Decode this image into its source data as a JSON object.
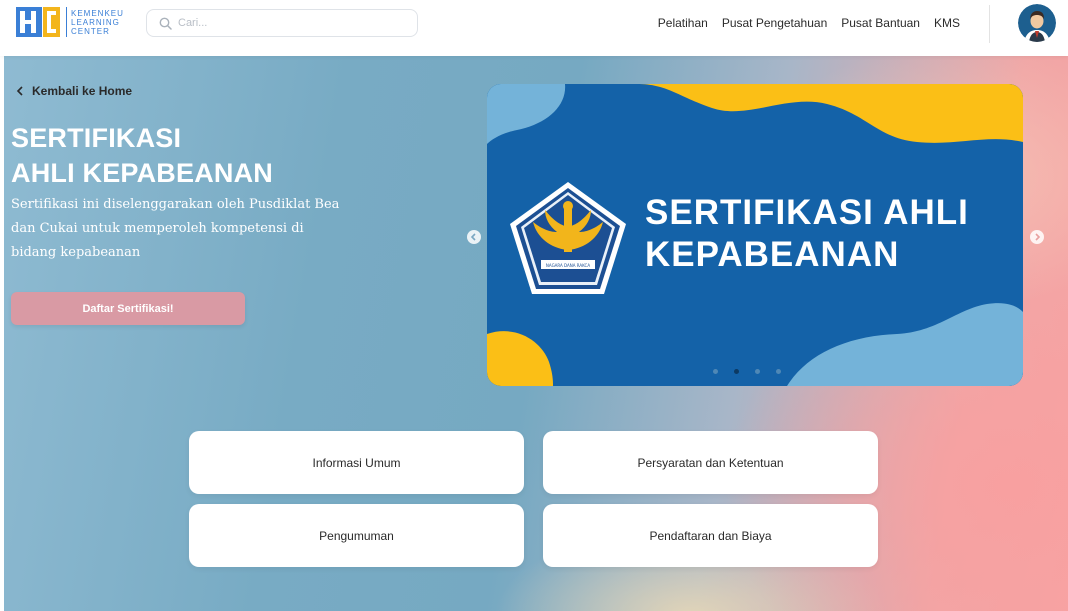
{
  "header": {
    "logo_lines": [
      "KEMENKEU",
      "LEARNING",
      "CENTER"
    ],
    "search_placeholder": "Cari...",
    "nav": [
      "Pelatihan",
      "Pusat Pengetahuan",
      "Pusat Bantuan",
      "KMS"
    ]
  },
  "hero": {
    "back_label": "Kembali ke Home",
    "title_line1": "SERTIFIKASI",
    "title_line2": "AHLI KEPABEANAN",
    "description": "Sertifikasi ini diselenggarakan oleh Pusdiklat Bea dan Cukai untuk memperoleh kompetensi di bidang kepabeanan",
    "cta_label": "Daftar Sertifikasi!"
  },
  "banner": {
    "text_line1": "SERTIFIKASI AHLI",
    "text_line2": "KEPABEANAN",
    "emblem_ribbon": "NAGARA DANA RAKCA",
    "slide_count": 4,
    "active_slide": 2
  },
  "cards": [
    "Informasi Umum",
    "Persyaratan dan Ketentuan",
    "Pengumuman",
    "Pendaftaran dan Biaya"
  ],
  "colors": {
    "brand_blue": "#3a7fd6",
    "brand_yellow": "#f3b51c",
    "banner_blue": "#1462a8",
    "banner_yellow": "#fbbf16",
    "cta_pink": "#d99aa4"
  }
}
